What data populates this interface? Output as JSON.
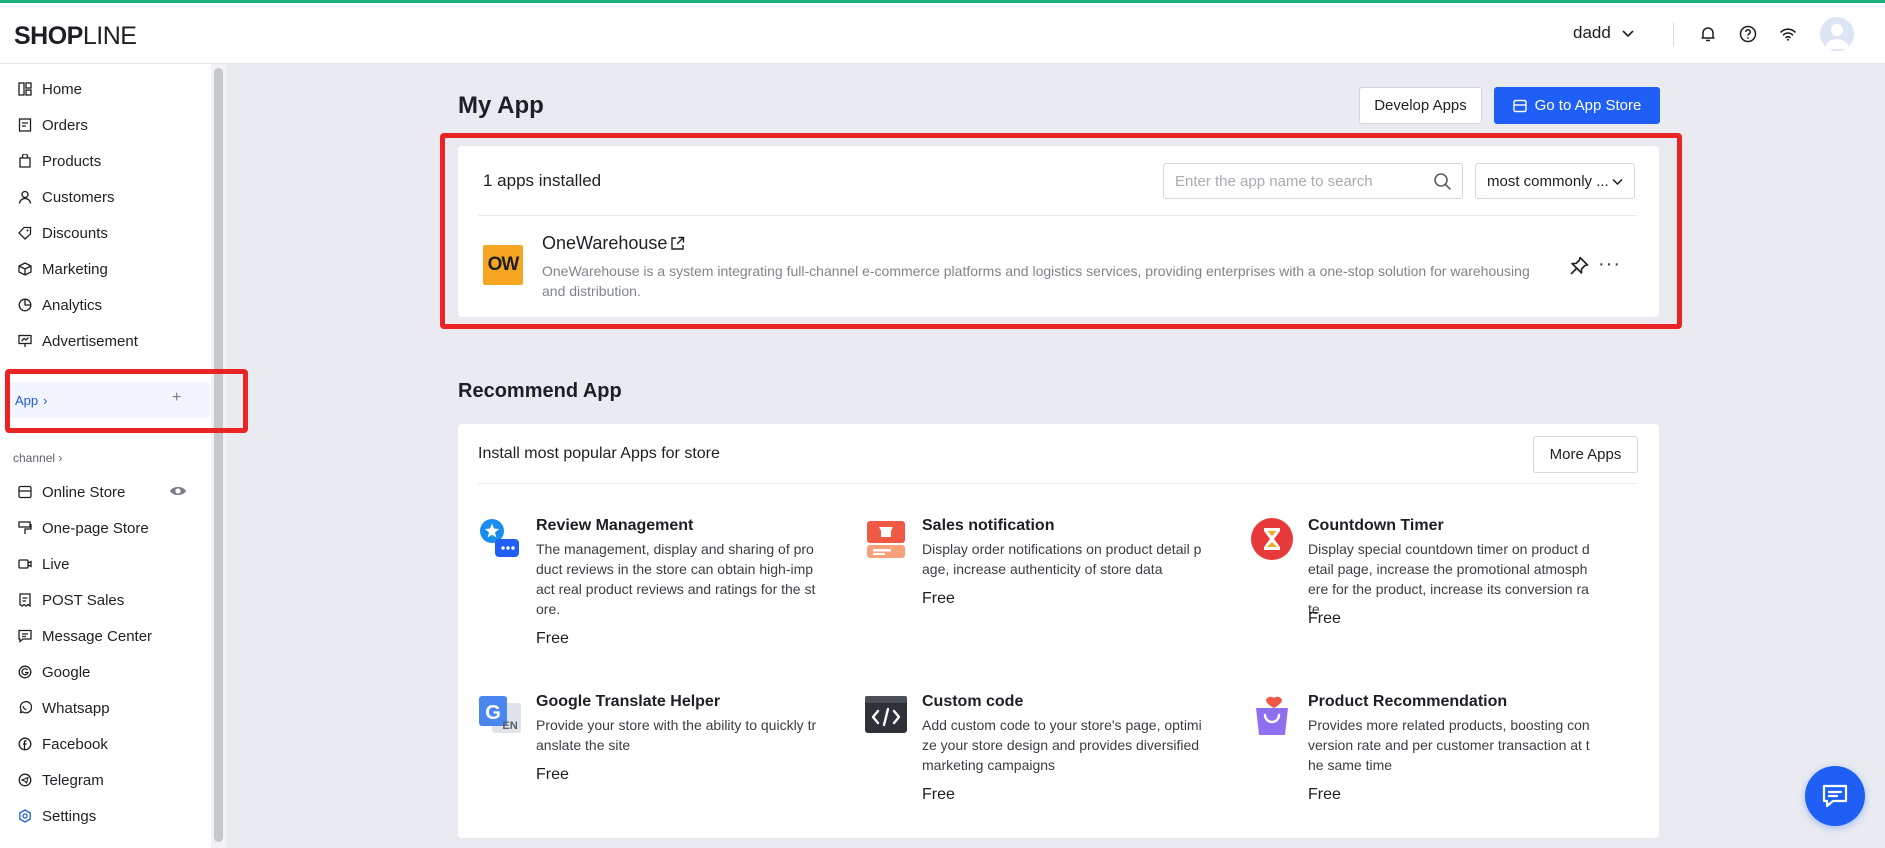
{
  "brand": {
    "logo_text_bold": "SHOP",
    "logo_text_thin": "LINE"
  },
  "header": {
    "user_name": "dadd"
  },
  "sidebar": {
    "items": [
      {
        "label": "Home",
        "icon": "home-icon"
      },
      {
        "label": "Orders",
        "icon": "orders-icon"
      },
      {
        "label": "Products",
        "icon": "products-icon"
      },
      {
        "label": "Customers",
        "icon": "customers-icon"
      },
      {
        "label": "Discounts",
        "icon": "discounts-icon"
      },
      {
        "label": "Marketing",
        "icon": "marketing-icon"
      },
      {
        "label": "Analytics",
        "icon": "analytics-icon"
      },
      {
        "label": "Advertisement",
        "icon": "advertisement-icon"
      }
    ],
    "app_section": {
      "label": "App",
      "chevron": "›",
      "add": "+"
    },
    "channel_label": "channel",
    "channel_chevron": "›",
    "channel_items": [
      {
        "label": "Online Store",
        "icon": "online-store-icon"
      },
      {
        "label": "One-page Store",
        "icon": "one-page-store-icon"
      },
      {
        "label": "Live",
        "icon": "live-icon"
      },
      {
        "label": "POST Sales",
        "icon": "post-sales-icon"
      },
      {
        "label": "Message Center",
        "icon": "message-center-icon"
      },
      {
        "label": "Google",
        "icon": "google-icon"
      },
      {
        "label": "Whatsapp",
        "icon": "whatsapp-icon"
      },
      {
        "label": "Facebook",
        "icon": "facebook-icon"
      },
      {
        "label": "Telegram",
        "icon": "telegram-icon"
      },
      {
        "label": "Settings",
        "icon": "settings-icon"
      }
    ]
  },
  "my_app": {
    "title": "My App",
    "develop_button": "Develop Apps",
    "store_button": "Go to App Store",
    "installed_count_label": "1 apps installed",
    "search_placeholder": "Enter the app name to search",
    "sort_selected": "most commonly ...",
    "apps": [
      {
        "logo_text": "OW",
        "name": "OneWarehouse",
        "description": "OneWarehouse is a system integrating full-channel e-commerce platforms and logistics services, providing enterprises with a one-stop solution for warehousing and distribution."
      }
    ]
  },
  "recommend": {
    "title": "Recommend App",
    "header": "Install most popular Apps for store",
    "more_button": "More Apps",
    "items": [
      {
        "name": "Review Management",
        "description": "The management, display and sharing of product reviews in the store can obtain high-impact real product reviews and ratings for the store.",
        "price": "Free"
      },
      {
        "name": "Sales notification",
        "description": "Display order notifications on product detail page, increase authenticity of store data",
        "price": "Free"
      },
      {
        "name": "Countdown Timer",
        "description": "Display special countdown timer on product detail page, increase the promotional atmosphere for the product, increase its conversion rate",
        "price": "Free"
      },
      {
        "name": "Google Translate Helper",
        "description": "Provide your store with the ability to quickly translate the site",
        "price": "Free"
      },
      {
        "name": "Custom code",
        "description": "Add custom code to your store's page, optimize your store design and provides diversified marketing campaigns",
        "price": "Free"
      },
      {
        "name": "Product Recommendation",
        "description": "Provides more related products, boosting conversion rate and per customer transaction at the same time",
        "price": "Free"
      }
    ]
  },
  "colors": {
    "primary": "#1f5ff5",
    "highlight": "#ea2424",
    "brand_line": "#19b07a",
    "ow_logo": "#f6a623"
  }
}
